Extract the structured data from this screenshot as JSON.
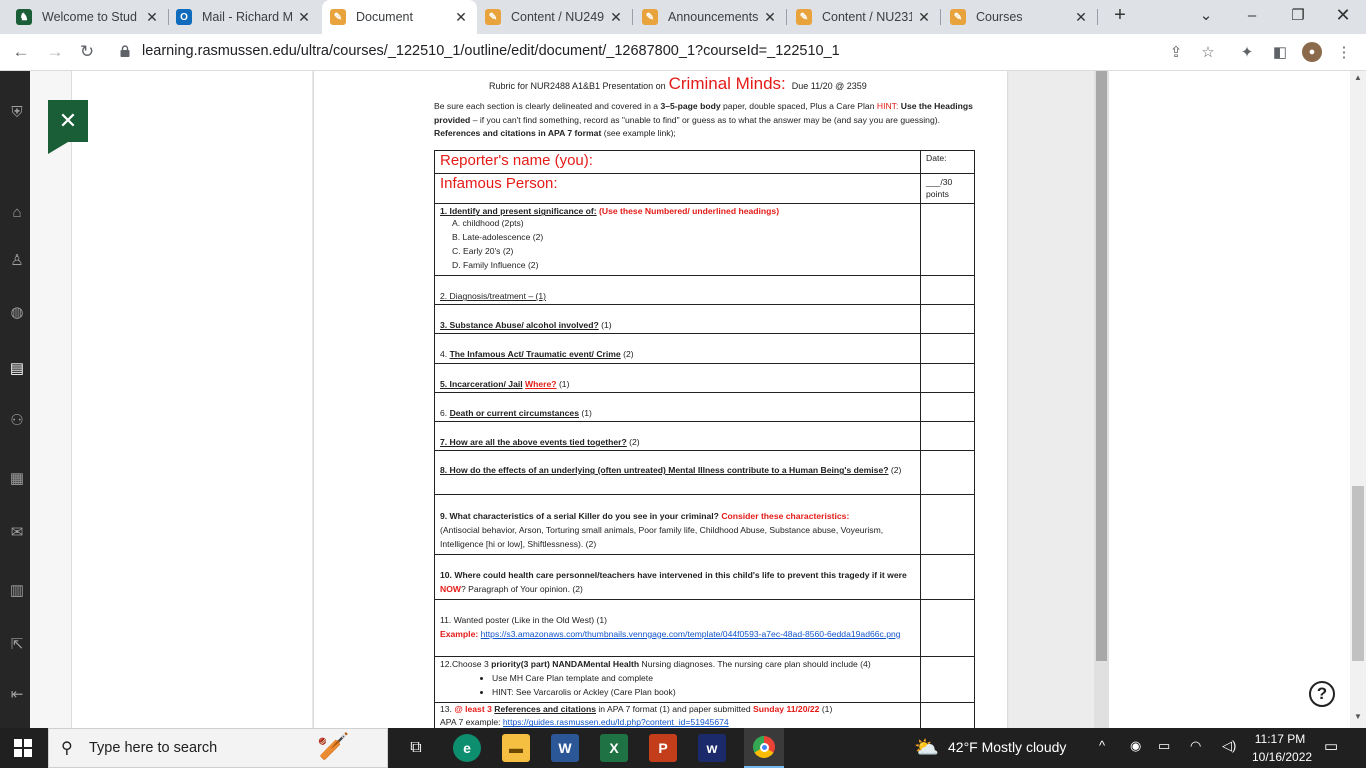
{
  "browser": {
    "tabs": [
      {
        "title": "Welcome to Stud",
        "color": "#1a5e38",
        "glyph": "♞"
      },
      {
        "title": "Mail - Richard Ma",
        "color": "#0f6cbd",
        "glyph": "O"
      },
      {
        "title": "Document",
        "color": "#e8a33d",
        "glyph": "✎"
      },
      {
        "title": "Content / NU249",
        "color": "#e8a33d",
        "glyph": "✎"
      },
      {
        "title": "Announcements",
        "color": "#e8a33d",
        "glyph": "✎"
      },
      {
        "title": "Content / NU231",
        "color": "#e8a33d",
        "glyph": "✎"
      },
      {
        "title": "Courses",
        "color": "#e8a33d",
        "glyph": "✎"
      }
    ],
    "active_tab": 2,
    "url": "learning.rasmussen.edu/ultra/courses/_122510_1/outline/edit/document/_12687800_1?courseId=_122510_1"
  },
  "document": {
    "title_prefix": "Rubric for NUR2488 A1&B1 Presentation on",
    "title_highlight": "Criminal Minds:",
    "title_due": "Due 11/20 @ 2359",
    "intro": {
      "p1": "Be sure each section is clearly delineated and covered in a",
      "p2": "3–5-page body",
      "p3": "paper, double spaced, Plus a Care Plan",
      "p4": "HINT:",
      "p5": "Use the Headings provided",
      "p6": "– if you can't find something, record as \"unable to find\" or guess as to what the answer may be (and say you are guessing).",
      "p7": "References and citations in APA 7 format",
      "p8": "(see example link);"
    },
    "reporter_label": "Reporter's name (you):",
    "infamous_label": "Infamous Person:",
    "date_label": "Date:",
    "points_label": "___/30 points",
    "sec1_heading": "1. Identify and present significance of:",
    "sec1_note": "(Use these Numbered/ underlined headings)",
    "sec1_items": [
      "A.  childhood (2pts)",
      "B.  Late-adolescence (2)",
      "C.  Early 20's (2)",
      "D.  Family Influence (2)"
    ],
    "sec2": "2. Diagnosis/treatment – (1)",
    "sec3_head": "3.  Substance Abuse/ alcohol involved?",
    "sec3_pts": "(1)",
    "sec4_head": "The Infamous Act/ Traumatic event/ Crime",
    "sec4_num": "4.",
    "sec4_pts": "(2)",
    "sec5_head": "5.  Incarceration/ Jail",
    "sec5_where": "Where?",
    "sec5_pts": "(1)",
    "sec6_num": "6.",
    "sec6_head": "Death or current circumstances",
    "sec6_pts": "(1)",
    "sec7_head": "7. How are all the above events tied together?",
    "sec7_pts": "(2)",
    "sec8_head": "8.  How do the effects of an underlying (often untreated) Mental Illness contribute to a Human Being's demise?",
    "sec8_pts": "(2)",
    "sec9_head": "9.  What characteristics of a serial Killer do you see in your criminal?",
    "sec9_note": "Consider these characteristics:",
    "sec9_body": "(Antisocial behavior, Arson, Torturing small animals, Poor family life, Childhood Abuse, Substance abuse, Voyeurism, Intelligence [hi or low], Shiftlessness).  (2)",
    "sec10_head": "10.  Where could health care personnel/teachers have intervened in this child's life to prevent this tragedy if it were",
    "sec10_now": "NOW",
    "sec10_tail": "? Paragraph of Your opinion.   (2)",
    "sec11_head": "11.  Wanted poster (Like in the Old West) (1)",
    "sec11_example": "Example:",
    "sec11_link": "https://s3.amazonaws.com/thumbnails.venngage.com/template/044f0593-a7ec-48ad-8560-6edda19ad66c.png",
    "sec12_a": "12.Choose 3",
    "sec12_b": "priority(3 part) NANDAMental Health",
    "sec12_c": "Nursing diagnoses. The nursing care plan should include (4)",
    "sec12_items": [
      "Use MH Care Plan template and complete",
      "HINT:  See Varcarolis or Ackley (Care Plan book)"
    ],
    "sec13_num": "13.",
    "sec13_least": "@ least 3",
    "sec13_refs": "References and citations",
    "sec13_mid": "in APA 7 format (1) and paper submitted",
    "sec13_date": "Sunday 11/20/22",
    "sec13_pts": "(1)",
    "sec13_apa": "APA 7 example:",
    "sec13_link": "https://guides.rasmussen.edu/ld.php?content_id=51945674"
  },
  "ui": {
    "help_glyph": "?",
    "close_glyph": "✕"
  },
  "taskbar": {
    "search_placeholder": "Type here to search",
    "weather": "42°F  Mostly cloudy",
    "time": "11:17 PM",
    "date": "10/16/2022"
  }
}
